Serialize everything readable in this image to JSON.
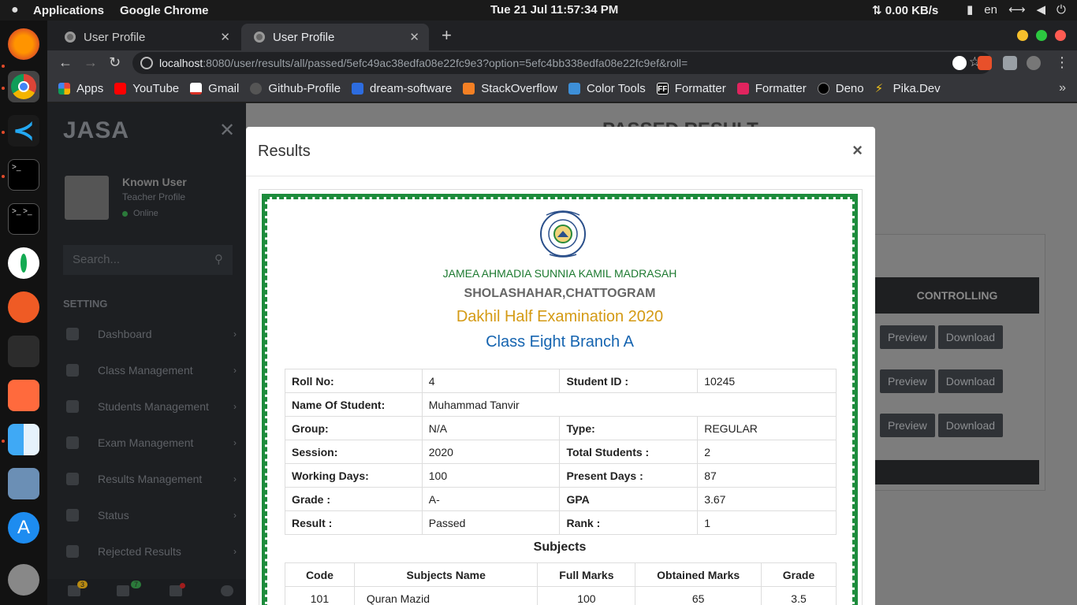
{
  "os": {
    "applications_label": "Applications",
    "active_app": "Google Chrome",
    "clock": "Tue 21 Jul  11:57:34 PM",
    "network": "⇅ 0.00 KB/s",
    "lang": "en"
  },
  "browser": {
    "tabs": [
      {
        "title": "User Profile"
      },
      {
        "title": "User Profile"
      }
    ],
    "url_host": "localhost",
    "url_rest": ":8080/user/results/all/passed/5efc49ac38edfa08e22fc9e3?option=5efc4bb338edfa08e22fc9ef&roll=",
    "bookmarks": [
      {
        "label": "Apps",
        "color": "#e8453c"
      },
      {
        "label": "YouTube",
        "color": "#ff0000"
      },
      {
        "label": "Gmail",
        "color": "#ffffff"
      },
      {
        "label": "Github-Profile",
        "color": "#444444"
      },
      {
        "label": "dream-software",
        "color": "#2d6cdf"
      },
      {
        "label": "StackOverflow",
        "color": "#f48024"
      },
      {
        "label": "Color Tools",
        "color": "#3d8fd8"
      },
      {
        "label": "Formatter",
        "color": "#111111"
      },
      {
        "label": "Formatter",
        "color": "#e0245e"
      },
      {
        "label": "Deno",
        "color": "#000000"
      },
      {
        "label": "Pika.Dev",
        "color": "#f5c518"
      }
    ]
  },
  "sidebar": {
    "brand": "JASA",
    "user_name": "Known User",
    "user_role": "Teacher Profile",
    "user_status": "Online",
    "search_placeholder": "Search...",
    "section_heading": "SETTING",
    "items": [
      {
        "label": "Dashboard"
      },
      {
        "label": "Class Management"
      },
      {
        "label": "Students Management"
      },
      {
        "label": "Exam Management"
      },
      {
        "label": "Results Management"
      },
      {
        "label": "Status"
      },
      {
        "label": "Rejected Results"
      }
    ],
    "footer": {
      "notifications": "3",
      "messages": "7"
    }
  },
  "main": {
    "title": "PASSED RESULT",
    "controlling_header": "CONTROLLING",
    "preview_label": "Preview",
    "download_label": "Download"
  },
  "modal": {
    "title": "Results",
    "close": "×",
    "institution": "JAMEA AHMADIA SUNNIA KAMIL MADRASAH",
    "city": "SHOLASHAHAR,CHATTOGRAM",
    "exam": "Dakhil Half Examination 2020",
    "class_branch": "Class Eight Branch A",
    "info": {
      "roll_label": "Roll No:",
      "roll": "4",
      "student_id_label": "Student ID :",
      "student_id": "10245",
      "name_label": "Name Of Student:",
      "name": "Muhammad Tanvir",
      "group_label": "Group:",
      "group": "N/A",
      "type_label": "Type:",
      "type": "REGULAR",
      "session_label": "Session:",
      "session": "2020",
      "total_label": "Total Students :",
      "total": "2",
      "working_label": "Working Days:",
      "working": "100",
      "present_label": "Present Days :",
      "present": "87",
      "grade_label": "Grade :",
      "grade": "A-",
      "gpa_label": "GPA",
      "gpa": "3.67",
      "result_label": "Result :",
      "result": "Passed",
      "rank_label": "Rank :",
      "rank": "1"
    },
    "subjects_title": "Subjects",
    "subjects_headers": [
      "Code",
      "Subjects Name",
      "Full Marks",
      "Obtained Marks",
      "Grade"
    ],
    "subjects": [
      {
        "code": "101",
        "name": "Quran Mazid",
        "full": "100",
        "obtained": "65",
        "grade": "3.5"
      }
    ]
  }
}
